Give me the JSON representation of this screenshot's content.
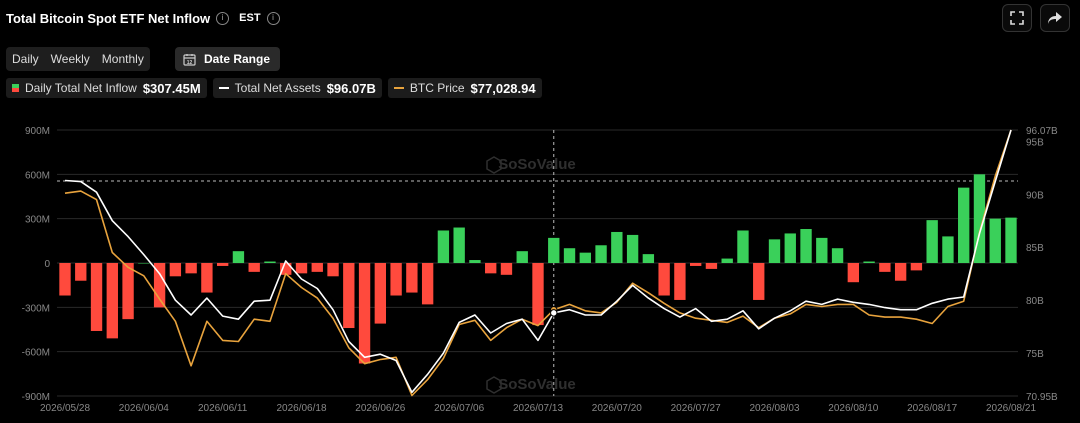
{
  "header": {
    "title": "Total Bitcoin Spot ETF Net Inflow",
    "timezone": "EST",
    "expand_icon": "fullscreen-icon",
    "share_icon": "share-icon"
  },
  "controls": {
    "periods": [
      {
        "label": "Daily",
        "active": true
      },
      {
        "label": "Weekly",
        "active": false
      },
      {
        "label": "Monthly",
        "active": false
      }
    ],
    "date_range_label": "Date Range"
  },
  "legend": [
    {
      "name": "Daily Total Net Inflow",
      "value": "$307.45M",
      "kind": "bar"
    },
    {
      "name": "Total Net Assets",
      "value": "$96.07B",
      "kind": "line",
      "color": "#ffffff"
    },
    {
      "name": "BTC Price",
      "value": "$77,028.94",
      "kind": "line",
      "color": "#e8a33d"
    }
  ],
  "watermark": "SoSoValue",
  "chart_data": {
    "type": "bar",
    "colors": {
      "positive": "#3ad05a",
      "negative": "#ff4a3d",
      "assets_line": "#ffffff",
      "btc_line": "#e8a33d"
    },
    "x_tick_labels": [
      "2026/05/28",
      "2026/06/04",
      "2026/06/11",
      "2026/06/18",
      "2026/06/26",
      "2026/07/06",
      "2026/07/13",
      "2026/07/20",
      "2026/07/27",
      "2026/08/03",
      "2026/08/10",
      "2026/08/17",
      "2026/08/21"
    ],
    "x_tick_indices": [
      0,
      5,
      10,
      15,
      20,
      25,
      30,
      35,
      40,
      45,
      50,
      55,
      60
    ],
    "left_axis": {
      "ylim": [
        -900,
        900
      ],
      "ticks": [
        900,
        600,
        300,
        0,
        -300,
        -600,
        -900
      ],
      "tick_labels": [
        "900M",
        "600M",
        "300M",
        "0",
        "-300M",
        "-600M",
        "-900M"
      ]
    },
    "right_axis": {
      "ylim": [
        70.95,
        96.07
      ],
      "ticks": [
        96.07,
        95,
        90,
        85,
        80,
        75,
        70.95
      ],
      "tick_labels": [
        "96.07B",
        "95B",
        "90B",
        "85B",
        "80B",
        "75B",
        "70.95B"
      ]
    },
    "reference_line_left": 555,
    "crosshair_index": 31,
    "series": [
      {
        "name": "Daily Total Net Inflow",
        "axis": "left",
        "values": [
          -220,
          -120,
          -460,
          -510,
          -380,
          0,
          -300,
          -90,
          -70,
          -200,
          -20,
          80,
          -60,
          10,
          -80,
          -70,
          -60,
          -90,
          -440,
          -680,
          -410,
          -220,
          -200,
          -280,
          220,
          240,
          20,
          -70,
          -80,
          80,
          -420,
          170,
          100,
          70,
          120,
          210,
          190,
          60,
          -220,
          -250,
          -20,
          -40,
          30,
          220,
          -250,
          160,
          200,
          230,
          170,
          100,
          -130,
          10,
          -60,
          -120,
          -50,
          290,
          180,
          510,
          600,
          300,
          307
        ]
      },
      {
        "name": "Total Net Assets",
        "axis": "right",
        "values": [
          91.3,
          91.2,
          90.2,
          87.5,
          86.0,
          84.3,
          82.5,
          80.0,
          78.6,
          80.2,
          78.5,
          78.2,
          79.9,
          80.0,
          83.7,
          82.0,
          81.1,
          79.1,
          76.1,
          74.6,
          74.9,
          74.3,
          71.3,
          73.0,
          75.0,
          77.9,
          78.6,
          76.9,
          77.8,
          78.2,
          76.2,
          78.8,
          79.1,
          78.6,
          78.6,
          79.9,
          81.4,
          80.2,
          79.2,
          78.4,
          79.2,
          78.0,
          78.2,
          79.0,
          77.3,
          78.3,
          79.0,
          79.9,
          79.6,
          80.1,
          79.8,
          79.6,
          79.3,
          79.1,
          79.1,
          79.7,
          80.1,
          80.3,
          86.3,
          91.2,
          96.07
        ]
      },
      {
        "name": "BTC Price",
        "axis": "right",
        "values": [
          90.1,
          90.3,
          89.5,
          84.5,
          83.1,
          82.3,
          80.1,
          78.0,
          73.8,
          78.0,
          76.2,
          76.1,
          78.2,
          78.0,
          82.5,
          81.2,
          80.2,
          78.3,
          75.5,
          74.0,
          74.4,
          74.6,
          71.0,
          72.5,
          74.5,
          77.7,
          78.1,
          76.2,
          77.4,
          78.2,
          77.6,
          79.1,
          79.6,
          79.0,
          78.8,
          79.8,
          81.6,
          80.7,
          79.7,
          78.8,
          78.3,
          78.1,
          77.9,
          78.5,
          77.4,
          78.3,
          78.7,
          79.6,
          79.4,
          79.6,
          79.6,
          78.6,
          78.4,
          78.4,
          78.2,
          77.8,
          79.4,
          79.9,
          86.4,
          91.7,
          96.07
        ]
      }
    ]
  }
}
